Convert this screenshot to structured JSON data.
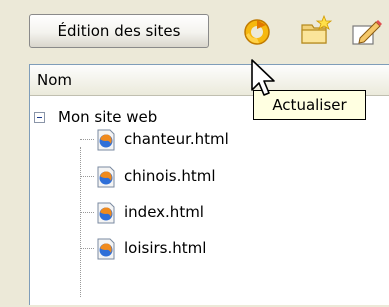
{
  "toolbar": {
    "sites_button_label": "Édition des sites",
    "icons": [
      "refresh-icon",
      "new-folder-icon",
      "edit-icon"
    ]
  },
  "column_header": {
    "name": "Nom"
  },
  "tree": {
    "root_label": "Mon site web",
    "files": [
      "chanteur.html",
      "chinois.html",
      "index.html",
      "loisirs.html"
    ]
  },
  "tooltip": {
    "text": "Actualiser"
  }
}
